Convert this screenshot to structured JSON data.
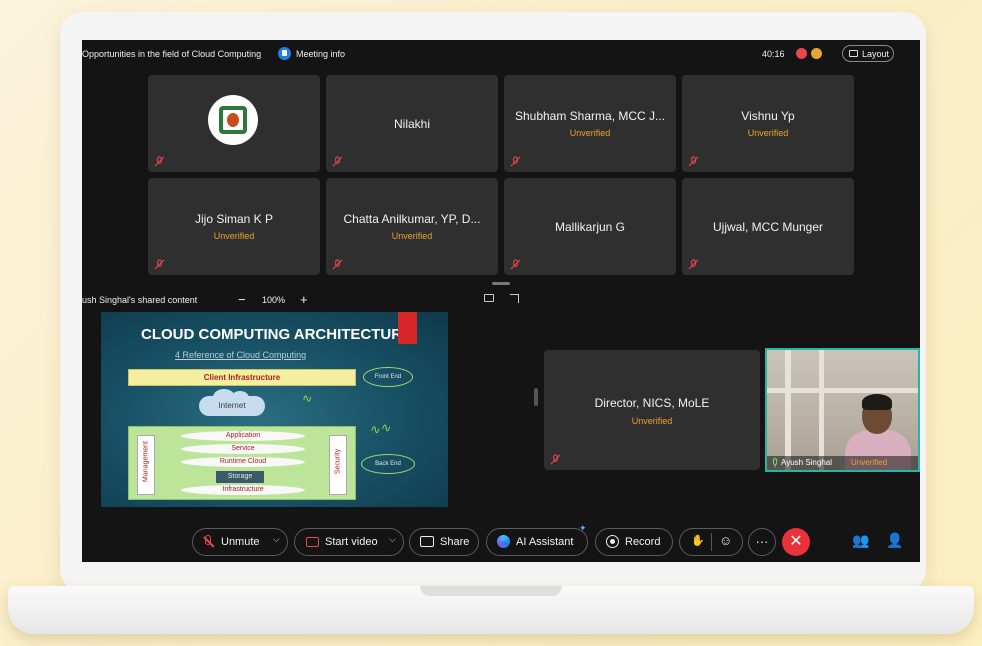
{
  "meeting": {
    "title": "Opportunities in the field of Cloud Computing",
    "info_label": "Meeting info",
    "timer": "40:16",
    "layout_label": "Layout"
  },
  "participants": [
    {
      "name": "",
      "status": ""
    },
    {
      "name": "Nilakhi",
      "status": ""
    },
    {
      "name": "Shubham Sharma, MCC J...",
      "status": "Unverified"
    },
    {
      "name": "Vishnu Yp",
      "status": "Unverified"
    },
    {
      "name": "Jijo Siman K P",
      "status": "Unverified"
    },
    {
      "name": "Chatta Anilkumar, YP, D...",
      "status": "Unverified"
    },
    {
      "name": "Mallikarjun G",
      "status": ""
    },
    {
      "name": "Ujjwal, MCC Munger",
      "status": ""
    }
  ],
  "share": {
    "label": "ush Singhal's shared content",
    "zoom_minus": "−",
    "zoom": "100%",
    "zoom_plus": "+"
  },
  "slide": {
    "title": "CLOUD COMPUTING ARCHITECTURE",
    "subtitle": "4 Reference of Cloud Computing",
    "client": "Client Infrastructure",
    "internet": "Internet",
    "management": "Management",
    "security": "Security",
    "layers": [
      "Application",
      "Service",
      "Runtime Cloud",
      "Storage",
      "Infrastructure"
    ],
    "front_end": "Front End",
    "back_end": "Back End"
  },
  "director": {
    "name": "Director, NICS, MoLE",
    "status": "Unverified"
  },
  "video": {
    "name": "Ayush Singhal",
    "status": "Unverified"
  },
  "controls": {
    "unmute": "Unmute",
    "start_video": "Start video",
    "share": "Share",
    "ai_assistant": "AI Assistant",
    "record": "Record",
    "more": "···",
    "end": "✕"
  },
  "colors": {
    "accent_orange": "#e8a531",
    "end_red": "#e8323a",
    "active_speaker": "#27b5a8"
  }
}
